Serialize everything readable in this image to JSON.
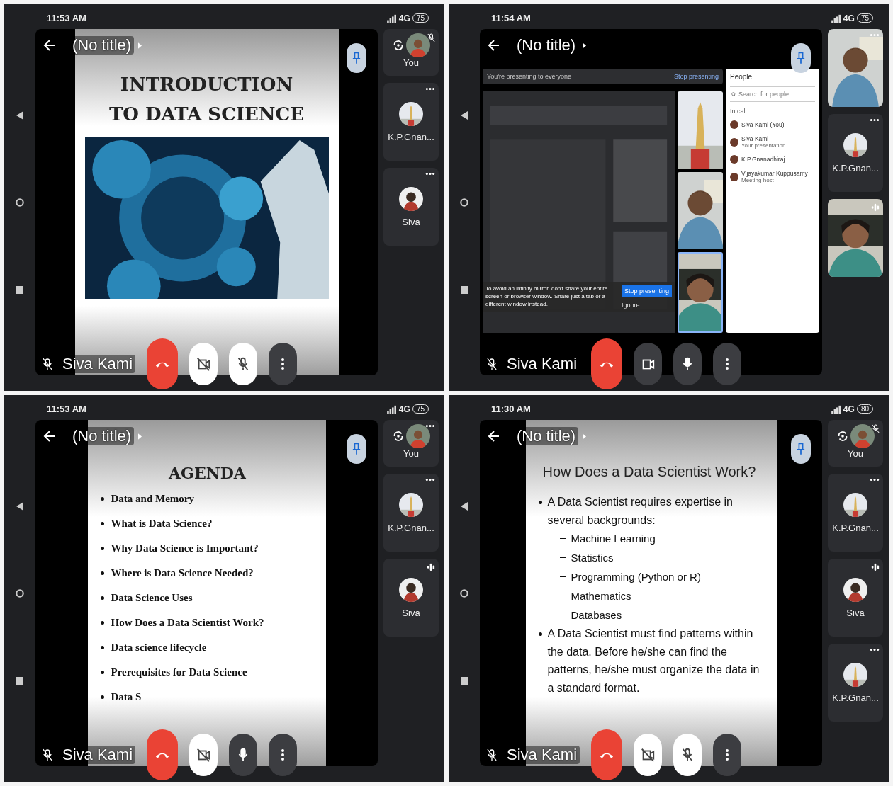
{
  "panels": [
    {
      "time": "11:53 AM",
      "network": "4G",
      "battery": "75",
      "title": "(No title)",
      "presenter": "Siva Kami",
      "camera_on": false,
      "mic_on": false,
      "slide": {
        "kind": "title",
        "heading": "INTRODUCTION TO DATA SCIENCE"
      },
      "tiles": [
        {
          "kind": "self",
          "label": "You",
          "muted": true
        },
        {
          "kind": "avatar",
          "label": "K.P.Gnan...",
          "more": true
        },
        {
          "kind": "avatar",
          "label": "Siva",
          "more": true
        }
      ]
    },
    {
      "time": "11:54 AM",
      "network": "4G",
      "battery": "75",
      "title": "(No title)",
      "presenter": "Siva Kami",
      "camera_on": true,
      "mic_on": true,
      "slide": {
        "kind": "screenshare",
        "banner": "You're presenting to everyone",
        "banner_link": "Stop presenting",
        "warning": "To avoid an infinity mirror, don't share your entire screen or browser window. Share just a tab or a different window instead.",
        "action": "Stop presenting",
        "ignore": "Ignore",
        "people_title": "People",
        "search_placeholder": "Search for people",
        "section": "In call",
        "people": [
          {
            "name": "Siva Kami (You)"
          },
          {
            "name": "Siva Kami",
            "note": "Your presentation"
          },
          {
            "name": "K.P.Gnanadhiraj"
          },
          {
            "name": "Vijayakumar Kuppusamy",
            "note": "Meeting host"
          }
        ]
      },
      "tiles": [
        {
          "kind": "video",
          "more": true
        },
        {
          "kind": "avatar",
          "label": "K.P.Gnan...",
          "more": true
        },
        {
          "kind": "video",
          "speaking": true
        }
      ]
    },
    {
      "time": "11:53 AM",
      "network": "4G",
      "battery": "75",
      "title": "(No title)",
      "presenter": "Siva Kami",
      "camera_on": false,
      "mic_on": true,
      "slide": {
        "kind": "agenda",
        "heading": "AGENDA",
        "items": [
          {
            "text": "Data and Memory"
          },
          {
            "text": "What is Data Science?"
          },
          {
            "text": "Why Data Science is Important?"
          },
          {
            "text": "Where is Data Science Needed?"
          },
          {
            "text": "Data Science Uses"
          },
          {
            "text": "How Does a Data Scientist Work?"
          },
          {
            "text": "Data science lifecycle"
          },
          {
            "text": "Prerequisites for Data Science"
          },
          {
            "text": "Data S"
          }
        ]
      },
      "tiles": [
        {
          "kind": "self",
          "label": "You",
          "more": true
        },
        {
          "kind": "avatar",
          "label": "K.P.Gnan...",
          "more": true
        },
        {
          "kind": "avatar",
          "label": "Siva",
          "speaking": true
        }
      ]
    },
    {
      "time": "11:30 AM",
      "network": "4G",
      "battery": "80",
      "title": "(No title)",
      "presenter": "Siva Kami",
      "camera_on": false,
      "mic_on": false,
      "slide": {
        "kind": "outline",
        "heading": "How Does a Data Scientist Work?",
        "items": [
          {
            "text": "A Data Scientist requires expertise in several backgrounds:",
            "children": [
              {
                "text": "Machine Learning"
              },
              {
                "text": "Statistics"
              },
              {
                "text": "Programming (Python or R)"
              },
              {
                "text": "Mathematics"
              },
              {
                "text": "Databases"
              }
            ]
          },
          {
            "text": "A Data Scientist must find patterns within the data. Before he/she can find the patterns, he/she must organize the data in a standard format."
          }
        ]
      },
      "tiles": [
        {
          "kind": "self",
          "label": "You",
          "muted": true
        },
        {
          "kind": "avatar",
          "label": "K.P.Gnan...",
          "more": true
        },
        {
          "kind": "avatar",
          "label": "Siva",
          "speaking": true
        },
        {
          "kind": "avatar",
          "label": "K.P.Gnan...",
          "more": true
        }
      ]
    }
  ]
}
